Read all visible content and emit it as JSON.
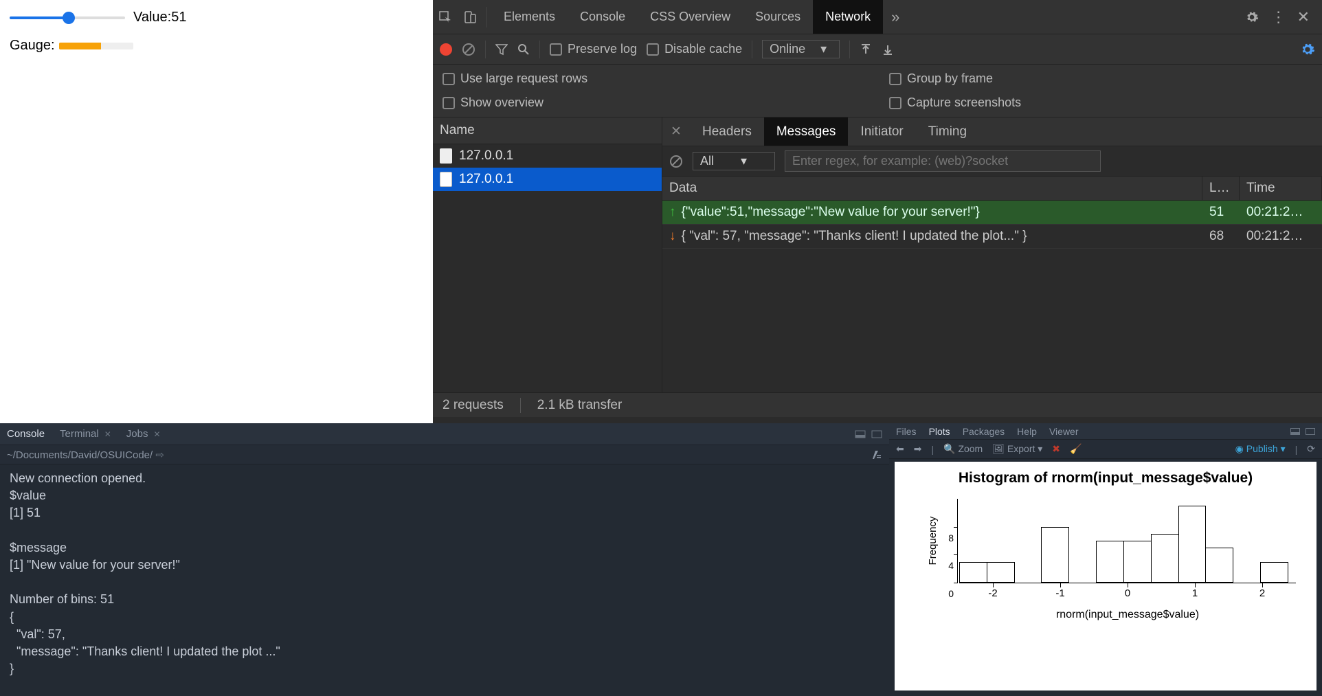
{
  "webpage": {
    "value_label": "Value:",
    "value": "51",
    "gauge_label": "Gauge:"
  },
  "devtools": {
    "tabs": [
      "Elements",
      "Console",
      "CSS Overview",
      "Sources",
      "Network"
    ],
    "active_tab": "Network",
    "toolbar": {
      "preserve_log": "Preserve log",
      "disable_cache": "Disable cache",
      "throttle": "Online"
    },
    "options": {
      "large_rows": "Use large request rows",
      "show_overview": "Show overview",
      "group_by_frame": "Group by frame",
      "capture_screenshots": "Capture screenshots"
    },
    "name_header": "Name",
    "requests": [
      {
        "name": "127.0.0.1"
      },
      {
        "name": "127.0.0.1"
      }
    ],
    "subtabs": [
      "Headers",
      "Messages",
      "Initiator",
      "Timing"
    ],
    "active_subtab": "Messages",
    "filter_all": "All",
    "regex_placeholder": "Enter regex, for example: (web)?socket",
    "columns": {
      "data": "Data",
      "length": "L…",
      "time": "Time"
    },
    "messages": [
      {
        "dir": "up",
        "data": "{\"value\":51,\"message\":\"New value for your server!\"}",
        "length": "51",
        "time": "00:21:2…"
      },
      {
        "dir": "down",
        "data": "{ \"val\": 57, \"message\": \"Thanks client! I updated the plot...\" }",
        "length": "68",
        "time": "00:21:2…"
      }
    ],
    "status": {
      "requests": "2 requests",
      "transfer": "2.1 kB transfer"
    }
  },
  "rstudio": {
    "console": {
      "tabs": [
        "Console",
        "Terminal",
        "Jobs"
      ],
      "path": "~/Documents/David/OSUICode/",
      "output": "New connection opened.\n$value\n[1] 51\n\n$message\n[1] \"New value for your server!\"\n\nNumber of bins: 51\n{\n  \"val\": 57,\n  \"message\": \"Thanks client! I updated the plot ...\"\n}"
    },
    "plots": {
      "tabs": [
        "Files",
        "Plots",
        "Packages",
        "Help",
        "Viewer"
      ],
      "active_tab": "Plots",
      "toolbar": {
        "zoom": "Zoom",
        "export": "Export",
        "publish": "Publish"
      }
    }
  },
  "chart_data": {
    "type": "bar",
    "title": "Histogram of rnorm(input_message$value)",
    "xlabel": "rnorm(input_message$value)",
    "ylabel": "Frequency",
    "x_breaks": [
      -2.5,
      -2.0,
      -1.5,
      -1.0,
      -0.5,
      0.0,
      0.5,
      1.0,
      1.5,
      2.0,
      2.5
    ],
    "values": [
      3,
      3,
      0,
      8,
      0,
      6,
      6,
      7,
      11,
      5,
      0,
      3
    ],
    "x_ticks": [
      -2,
      -1,
      0,
      1,
      2
    ],
    "y_ticks": [
      0,
      4,
      8
    ],
    "ylim": [
      0,
      12
    ]
  }
}
